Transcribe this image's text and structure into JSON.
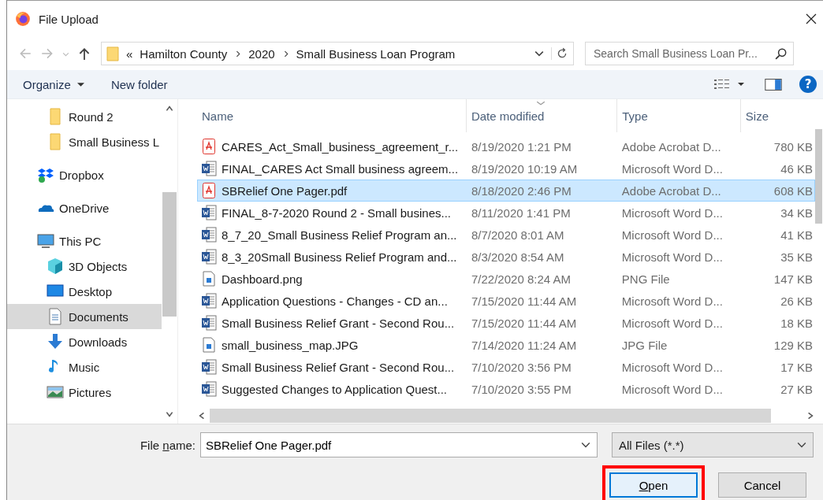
{
  "window": {
    "title": "File Upload"
  },
  "address": {
    "overflow": "«",
    "crumbs": [
      "Hamilton County",
      "2020",
      "Small Business Loan Program"
    ]
  },
  "search": {
    "placeholder": "Search Small Business Loan Pr..."
  },
  "toolbar": {
    "organize": "Organize",
    "new_folder": "New folder",
    "help": "?"
  },
  "sidebar": {
    "items": [
      {
        "label": "Round 2",
        "kind": "folder",
        "selected": false
      },
      {
        "label": "Small Business L",
        "kind": "folder",
        "selected": false
      },
      {
        "label": "Dropbox",
        "kind": "location",
        "selected": false
      },
      {
        "label": "OneDrive",
        "kind": "location",
        "selected": false
      },
      {
        "label": "This PC",
        "kind": "location",
        "selected": false,
        "children": [
          {
            "label": "3D Objects",
            "selected": false
          },
          {
            "label": "Desktop",
            "selected": false
          },
          {
            "label": "Documents",
            "selected": true
          },
          {
            "label": "Downloads",
            "selected": false
          },
          {
            "label": "Music",
            "selected": false
          },
          {
            "label": "Pictures",
            "selected": false
          }
        ]
      }
    ]
  },
  "table": {
    "columns": [
      {
        "label": "Name",
        "sorted": false
      },
      {
        "label": "Date modified",
        "sorted": true
      },
      {
        "label": "Type",
        "sorted": false
      },
      {
        "label": "Size",
        "sorted": false
      }
    ],
    "rows": [
      {
        "kind": "pdf",
        "name": "CARES_Act_Small_business_agreement_r...",
        "date": "8/19/2020 1:21 PM",
        "type": "Adobe Acrobat D...",
        "size": "780 KB",
        "selected": false
      },
      {
        "kind": "word",
        "name": "FINAL_CARES Act Small business agreem...",
        "date": "8/19/2020 10:19 AM",
        "type": "Microsoft Word D...",
        "size": "46 KB",
        "selected": false
      },
      {
        "kind": "pdf",
        "name": "SBRelief One Pager.pdf",
        "date": "8/18/2020 2:46 PM",
        "type": "Adobe Acrobat D...",
        "size": "608 KB",
        "selected": true
      },
      {
        "kind": "word",
        "name": "FINAL_8-7-2020 Round 2 - Small busines...",
        "date": "8/11/2020 1:41 PM",
        "type": "Microsoft Word D...",
        "size": "34 KB",
        "selected": false
      },
      {
        "kind": "word",
        "name": "8_7_20_Small Business Relief Program an...",
        "date": "8/7/2020 8:01 AM",
        "type": "Microsoft Word D...",
        "size": "41 KB",
        "selected": false
      },
      {
        "kind": "word",
        "name": "8_3_20Small Business Relief Program and...",
        "date": "8/3/2020 8:54 AM",
        "type": "Microsoft Word D...",
        "size": "35 KB",
        "selected": false
      },
      {
        "kind": "image",
        "name": "Dashboard.png",
        "date": "7/22/2020 8:24 AM",
        "type": "PNG File",
        "size": "147 KB",
        "selected": false
      },
      {
        "kind": "word",
        "name": "Application Questions - Changes - CD an...",
        "date": "7/15/2020 11:44 AM",
        "type": "Microsoft Word D...",
        "size": "26 KB",
        "selected": false
      },
      {
        "kind": "word",
        "name": "Small Business Relief Grant - Second Rou...",
        "date": "7/15/2020 11:44 AM",
        "type": "Microsoft Word D...",
        "size": "18 KB",
        "selected": false
      },
      {
        "kind": "image",
        "name": "small_business_map.JPG",
        "date": "7/14/2020 11:24 AM",
        "type": "JPG File",
        "size": "129 KB",
        "selected": false
      },
      {
        "kind": "word",
        "name": "Small Business Relief Grant - Second Rou...",
        "date": "7/10/2020 3:56 PM",
        "type": "Microsoft Word D...",
        "size": "17 KB",
        "selected": false
      },
      {
        "kind": "word",
        "name": "Suggested Changes to Application Quest...",
        "date": "7/10/2020 3:55 PM",
        "type": "Microsoft Word D...",
        "size": "27 KB",
        "selected": false
      }
    ]
  },
  "file_name": {
    "label": [
      {
        "text": "File ",
        "underline": false
      },
      {
        "text": "n",
        "underline": true
      },
      {
        "text": "ame:",
        "underline": false
      }
    ],
    "value": "SBRelief One Pager.pdf"
  },
  "file_type": {
    "value": "All Files (*.*)"
  },
  "buttons": [
    {
      "label": [
        {
          "text": "O",
          "underline": true
        },
        {
          "text": "pen",
          "underline": false
        }
      ],
      "kind": "open",
      "highlighted": true
    },
    {
      "label": [
        {
          "text": "Cancel",
          "underline": false
        }
      ],
      "kind": "cancel"
    }
  ]
}
